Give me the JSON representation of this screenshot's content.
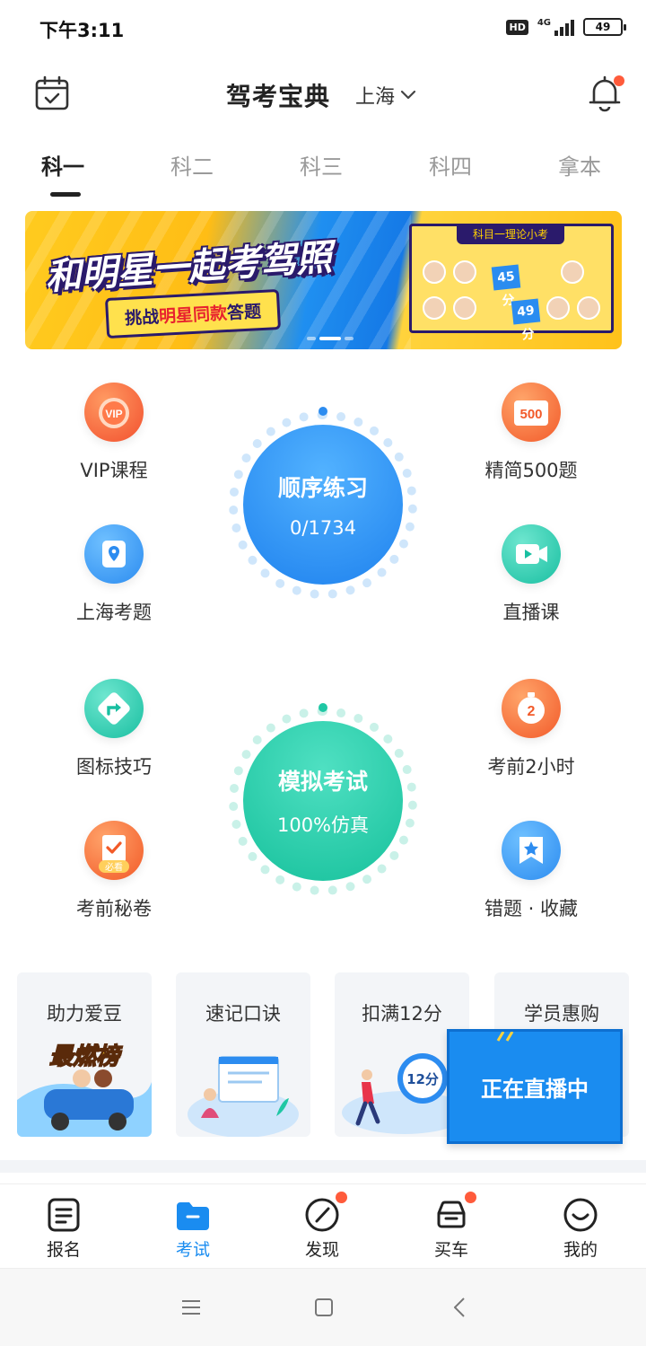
{
  "status_bar": {
    "time": "下午3:11",
    "hd": "HD",
    "network": "4G",
    "battery_level": "49",
    "battery_fraction": 0.49
  },
  "header": {
    "title": "驾考宝典",
    "city": "上海"
  },
  "tabs": [
    {
      "label": "科一",
      "active": true
    },
    {
      "label": "科二",
      "active": false
    },
    {
      "label": "科三",
      "active": false
    },
    {
      "label": "科四",
      "active": false
    },
    {
      "label": "拿本",
      "active": false
    }
  ],
  "banner": {
    "headline": "和明星一起考驾照",
    "sub_prefix": "挑战",
    "sub_highlight": "明星同款",
    "sub_suffix": "答题",
    "card_title": "科目一理论小考",
    "score_a": "45分",
    "score_b": "49分"
  },
  "features": {
    "vip": "VIP课程",
    "vip_badge": "VIP",
    "shanghai": "上海考题",
    "signs": "图标技巧",
    "secret": "考前秘卷",
    "secret_badge": "必看",
    "jingjian": "精简500题",
    "jingjian_badge": "500",
    "live_course": "直播课",
    "two_hours": "考前2小时",
    "two_hours_badge": "2",
    "mistakes": "错题 · 收藏"
  },
  "practice": {
    "label": "顺序练习",
    "progress": "0/1734",
    "done": 0,
    "total": 1734
  },
  "exam": {
    "label": "模拟考试",
    "sub": "100%仿真"
  },
  "promos": {
    "idol": "助力爱豆",
    "idol_art": "最燃榜",
    "mnemonic": "速记口诀",
    "deduct": "扣满12分",
    "deduct_badge": "12分",
    "student": "学员惠购",
    "live": "正在直播中"
  },
  "bottom_nav": [
    {
      "label": "报名",
      "icon": "signup-icon",
      "active": false,
      "dot": false
    },
    {
      "label": "考试",
      "icon": "exam-folder-icon",
      "active": true,
      "dot": false
    },
    {
      "label": "发现",
      "icon": "compass-icon",
      "active": false,
      "dot": true
    },
    {
      "label": "买车",
      "icon": "car-icon",
      "active": false,
      "dot": true
    },
    {
      "label": "我的",
      "icon": "smile-icon",
      "active": false,
      "dot": false
    }
  ],
  "colors": {
    "accent_blue": "#1a8cf0",
    "exam_green": "#1fc7a4",
    "badge_red": "#ff5b3b"
  }
}
